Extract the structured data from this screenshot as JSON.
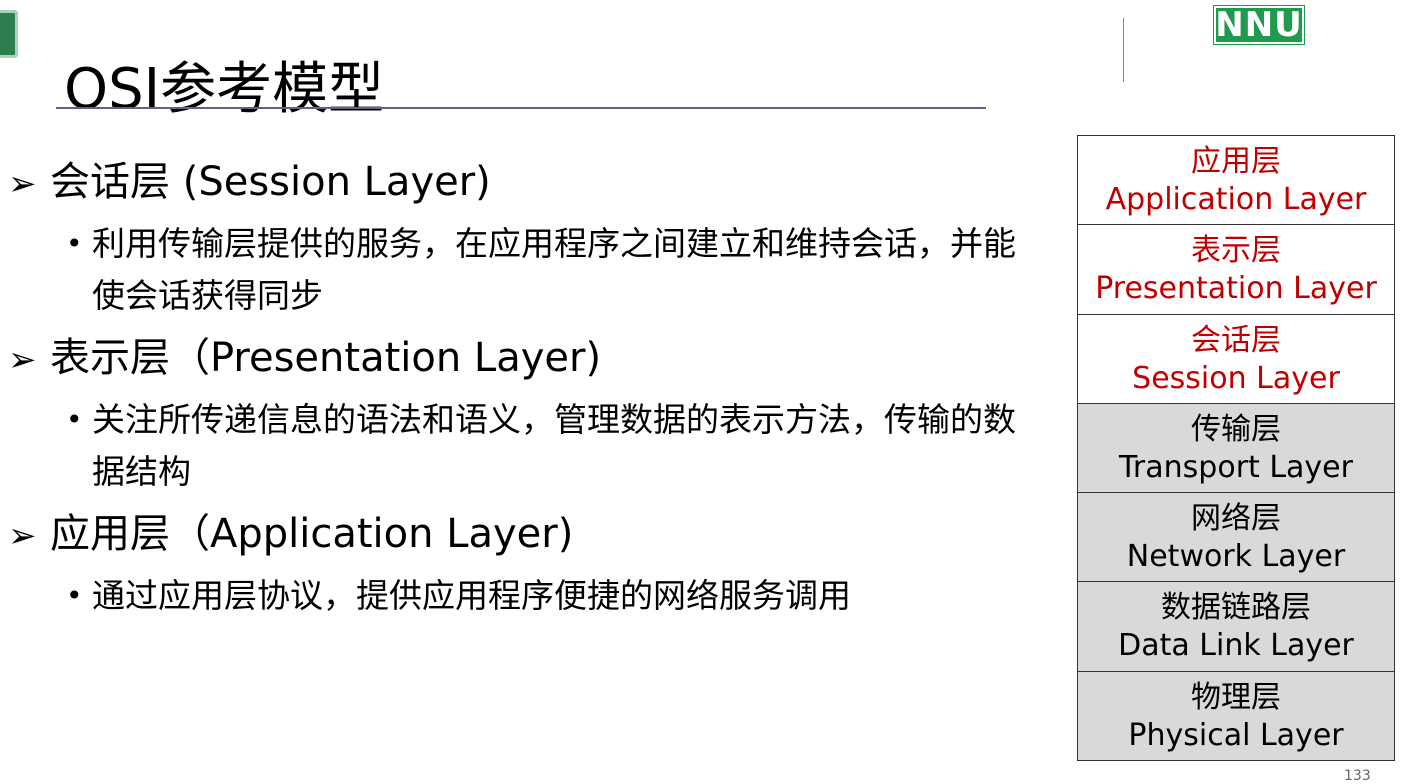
{
  "header": {
    "title": "OSI参考模型",
    "logo_text": "NNU"
  },
  "bullets": [
    {
      "marker": "➢",
      "heading": "会话层 (Session Layer)",
      "sub_marker": "•",
      "sub": "利用传输层提供的服务，在应用程序之间建立和维持会话，并能使会话获得同步"
    },
    {
      "marker": "➢",
      "heading": "表示层（Presentation Layer)",
      "sub_marker": "•",
      "sub": "关注所传递信息的语法和语义，管理数据的表示方法，传输的数据结构"
    },
    {
      "marker": "➢",
      "heading": "应用层（Application Layer)",
      "sub_marker": "•",
      "sub": "通过应用层协议，提供应用程序便捷的网络服务调用"
    }
  ],
  "osi_layers": [
    {
      "zh": "应用层",
      "en": "Application Layer"
    },
    {
      "zh": "表示层",
      "en": "Presentation Layer"
    },
    {
      "zh": "会话层",
      "en": "Session Layer"
    },
    {
      "zh": "传输层",
      "en": "Transport Layer"
    },
    {
      "zh": "网络层",
      "en": "Network Layer"
    },
    {
      "zh": "数据链路层",
      "en": "Data Link Layer"
    },
    {
      "zh": "物理层",
      "en": "Physical Layer"
    }
  ],
  "colors": {
    "highlight_text": "#c00000",
    "lower_layer_bg": "#d9d9d9",
    "rule": "#6b5a8e",
    "logo_green": "#1f9a4f"
  },
  "footer": {
    "page_number": "133"
  }
}
